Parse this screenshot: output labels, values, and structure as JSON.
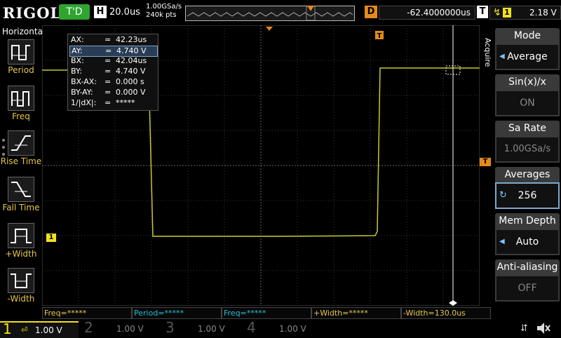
{
  "brand": "RIGOL",
  "run_state": "T'D",
  "timebase": {
    "label": "H",
    "value": "20.0us",
    "sample_rate": "1.00GSa/s",
    "points": "240k pts"
  },
  "delay": {
    "label": "D",
    "value": "-62.4000000us"
  },
  "trigger": {
    "label": "T",
    "source": "1",
    "level": "2.18 V"
  },
  "left_panel": {
    "title": "Horizontal",
    "items": [
      {
        "label": "Period"
      },
      {
        "label": "Freq"
      },
      {
        "label": "Rise Time"
      },
      {
        "label": "Fall Time"
      },
      {
        "label": "+Width"
      },
      {
        "label": "-Width"
      }
    ]
  },
  "cursor_readout": [
    {
      "name": "AX:",
      "eq": "=",
      "value": "42.23us"
    },
    {
      "name": "AY:",
      "eq": "=",
      "value": "4.740 V"
    },
    {
      "name": "BX:",
      "eq": "=",
      "value": "42.04us"
    },
    {
      "name": "BY:",
      "eq": "=",
      "value": "4.740 V"
    },
    {
      "name": "BX-AX:",
      "eq": "=",
      "value": "0.000 s"
    },
    {
      "name": "BY-AY:",
      "eq": "=",
      "value": "0.000 V"
    },
    {
      "name": "1/|dX|:",
      "eq": "=",
      "value": "*****"
    }
  ],
  "right_menu": {
    "side_label": "Acquire",
    "items": [
      {
        "title": "Mode",
        "value": "Average"
      },
      {
        "title": "Sin(x)/x",
        "value": "ON"
      },
      {
        "title": "Sa Rate",
        "value": "1.00GSa/s"
      },
      {
        "title": "Averages",
        "value": "256"
      },
      {
        "title": "Mem Depth",
        "value": "Auto"
      },
      {
        "title": "Anti-aliasing",
        "value": "OFF"
      }
    ]
  },
  "measurements": [
    {
      "text": "Freq=*****"
    },
    {
      "text": "Period=*****"
    },
    {
      "text": "Freq=*****"
    },
    {
      "text": "+Width=*****"
    },
    {
      "text": "-Width=130.0us"
    }
  ],
  "channels": [
    {
      "num": "1",
      "scale": "1.00 V",
      "color": "#f2e21b"
    },
    {
      "num": "2",
      "scale": "1.00 V",
      "color": "#22c1d6"
    },
    {
      "num": "3",
      "scale": "1.00 V",
      "color": "#d12bd1"
    },
    {
      "num": "4",
      "scale": "1.00 V",
      "color": "#3a7bd5"
    }
  ],
  "colors": {
    "ch1": "#c8c832",
    "trigger": "#e58a1a",
    "cursor": "#ffffff",
    "run": "#2fa52f"
  },
  "grid_markers": {
    "ch1_marker": "1",
    "trigger_marker": "T"
  }
}
